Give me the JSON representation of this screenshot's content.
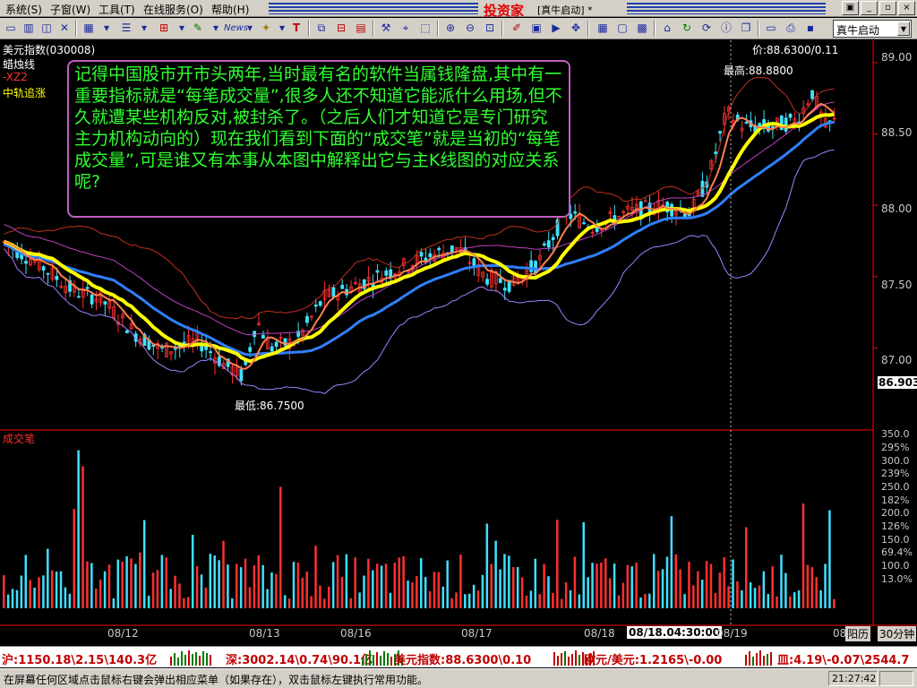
{
  "menubar": {
    "items": [
      "系统(S)",
      "子窗(W)",
      "工具(T)",
      "在线服务(O)",
      "帮助(H)"
    ],
    "app_title": "投资家",
    "doc_title": "[真牛启动] *",
    "win_buttons": [
      "▣",
      "_",
      "▫",
      "×"
    ]
  },
  "toolbar": {
    "formula": "真牛启动"
  },
  "chart": {
    "instrument": "美元指数(030008)",
    "indicator_1": "蜡烛线",
    "indicator_2": "-XZ2",
    "indicator_3": "中轨追涨",
    "price_info": "价:88.6300/0.11",
    "high_label": "最高:88.8800",
    "low_label": "最低:86.7500",
    "current_price_label": "86.903",
    "price_ticks": [
      "89.00",
      "88.50",
      "88.00",
      "87.50",
      "87.00"
    ],
    "volume_title": "成交笔",
    "volume_ticks": [
      "350.0",
      "295%",
      "300.0",
      "239%",
      "250.0",
      "182%",
      "200.0",
      "126%",
      "150.0",
      "69.4%",
      "100.0",
      "13.0%"
    ],
    "date_labels": [
      "08/12",
      "08/13",
      "08/16",
      "08/17",
      "08/18",
      "08/18.04:30:00",
      "08/19",
      "08"
    ],
    "tab_period": "阳历",
    "tab_timeframe": "30分钟",
    "colors": {
      "up": "#ff3030",
      "down": "#40e0ff",
      "ma_yellow": "#ffff00",
      "ma_blue": "#3080ff",
      "ma_orange": "#ff8050",
      "band": "#a080ff",
      "upper": "#c03020",
      "axis": "#ff0000"
    }
  },
  "note": {
    "text": "记得中国股市开市头两年,当时最有名的软件当属钱隆盘,其中有一重要指标就是“每笔成交量”,很多人还不知道它能派什么用场,但不久就遭某些机构反对,被封杀了。（之后人们才知道它是专门研究主力机构动向的）现在我们看到下面的“成交笔”就是当初的“每笔成交量”,可是谁又有本事从本图中解释出它与主K线图的对应关系呢?"
  },
  "ticker": {
    "sh": "沪:1150.18\\2.15\\140.3亿",
    "sz": "深:3002.14\\0.74\\90.1亿",
    "usd": "美元指数:88.6300\\0.10",
    "eur": "欧元/美元:1.2165\\-0.00",
    "other": "皿:4.19\\-0.07\\2544.7"
  },
  "statusbar": {
    "text": "在屏幕任何区域点击鼠标右键会弹出相应菜单（如果存在），双击鼠标左键执行常用功能。",
    "time": "21:27:42"
  }
}
